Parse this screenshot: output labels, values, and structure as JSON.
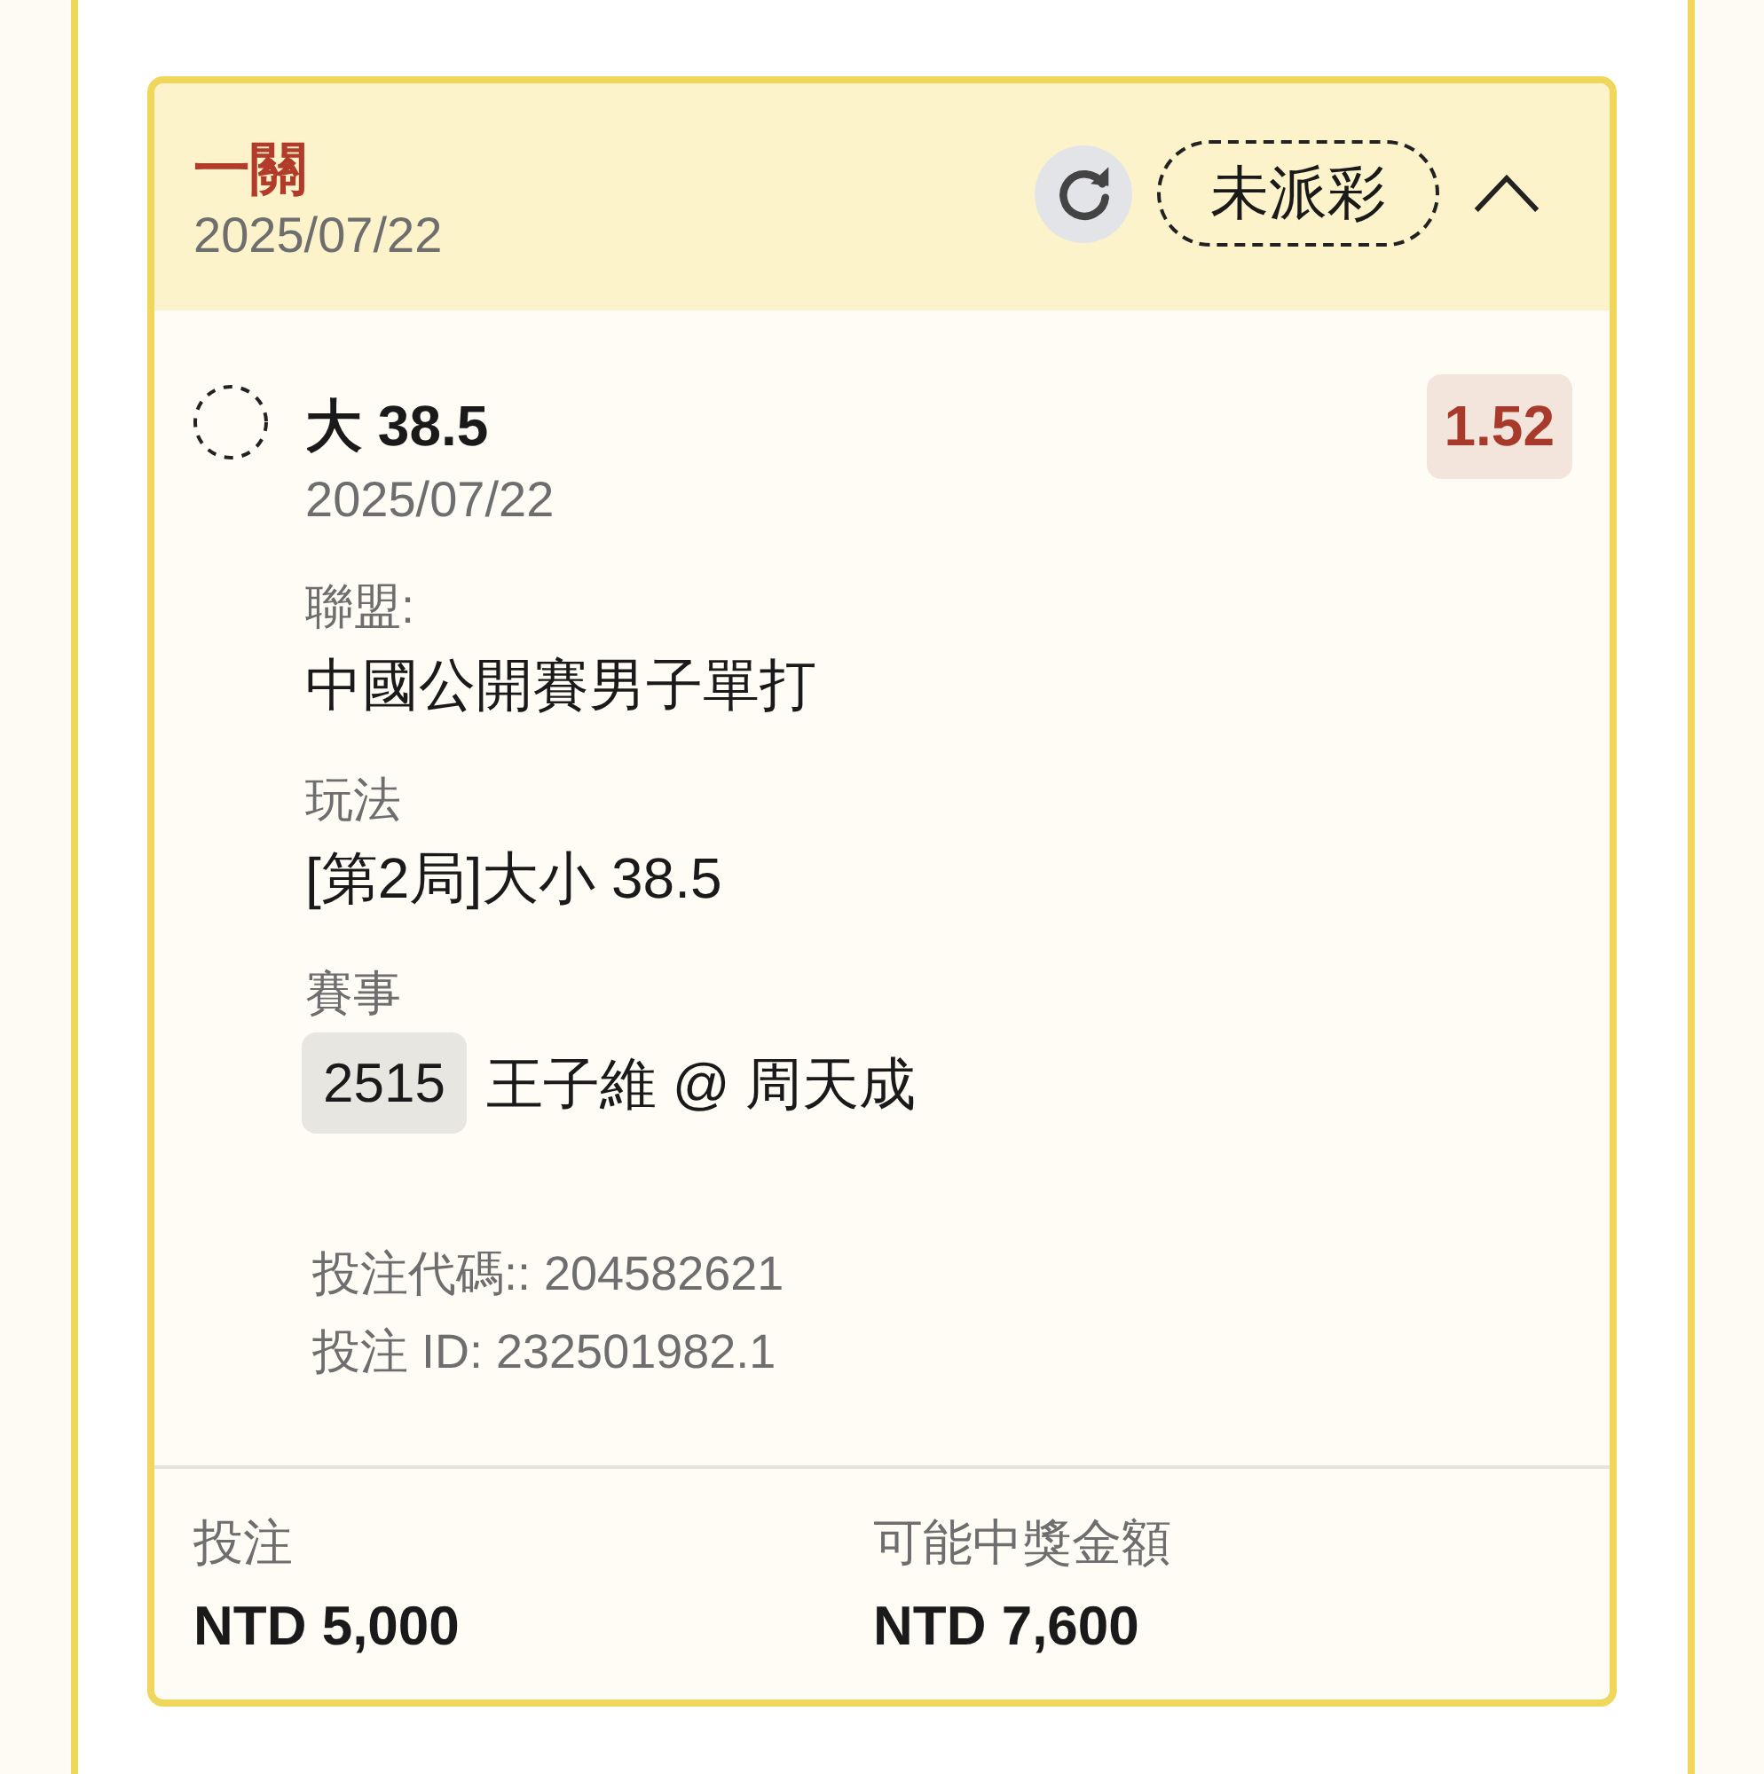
{
  "card": {
    "title": "一關",
    "date": "2025/07/22",
    "status": "未派彩",
    "expanded": true
  },
  "selection": {
    "pick": "大 38.5",
    "date": "2025/07/22",
    "odds": "1.52"
  },
  "details": [
    {
      "kind": "text",
      "label": "聯盟:",
      "value": "中國公開賽男子單打"
    },
    {
      "kind": "text",
      "label": "玩法",
      "value": "[第2局]大小 38.5"
    },
    {
      "kind": "match",
      "label": "賽事",
      "match_number": "2515",
      "value": "王子維 @ 周天成"
    }
  ],
  "references": [
    "投注代碼:: 204582621",
    "投注 ID: 232501982.1"
  ],
  "summary": [
    {
      "label": "投注",
      "amount": "NTD 5,000"
    },
    {
      "label": "可能中獎金額",
      "amount": "NTD 7,600"
    }
  ]
}
